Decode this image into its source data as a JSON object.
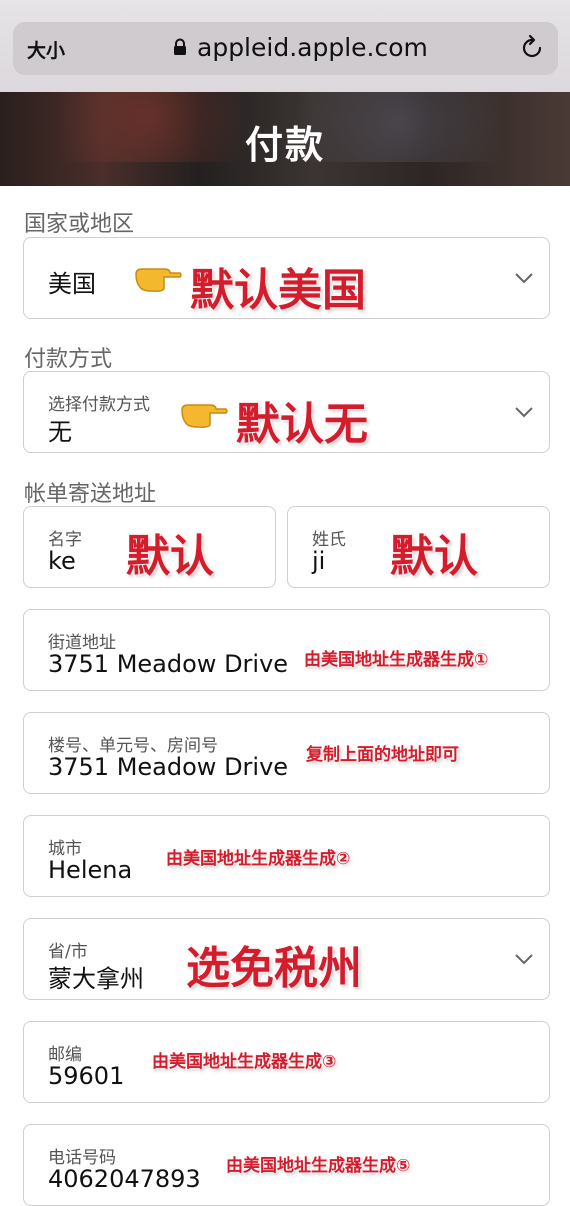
{
  "browser": {
    "text_size_label": "大小",
    "url": "appleid.apple.com"
  },
  "page": {
    "title": "付款"
  },
  "form": {
    "country_section": "国家或地区",
    "country_value": "美国",
    "payment_section": "付款方式",
    "payment_label": "选择付款方式",
    "payment_value": "无",
    "billing_section": "帐单寄送地址",
    "first_name_label": "名字",
    "first_name_value": "ke",
    "last_name_label": "姓氏",
    "last_name_value": "ji",
    "street_label": "街道地址",
    "street_value": "3751  Meadow Drive",
    "apt_label": "楼号、单元号、房间号",
    "apt_value": "3751  Meadow Drive",
    "city_label": "城市",
    "city_value": "Helena",
    "state_label": "省/市",
    "state_value": "蒙大拿州",
    "zip_label": "邮编",
    "zip_value": "59601",
    "phone_label": "电话号码",
    "phone_value": "4062047893"
  },
  "annotations": {
    "country_note": "默认美国",
    "payment_note": "默认无",
    "first_name_note": "默认",
    "last_name_note": "默认",
    "street_note": "由美国地址生成器生成①",
    "apt_note": "复制上面的地址即可",
    "city_note": "由美国地址生成器生成②",
    "state_note": "选免税州",
    "zip_note": "由美国地址生成器生成③",
    "phone_note": "由美国地址生成器生成⑤"
  },
  "icons": {
    "lock": "lock-icon",
    "reload": "reload-icon",
    "chevron": "chevron-down-icon",
    "hand": "pointing-hand-icon"
  },
  "colors": {
    "annotation": "#d31c2c",
    "field_border": "#cfcfcf",
    "section_label": "#666666"
  }
}
